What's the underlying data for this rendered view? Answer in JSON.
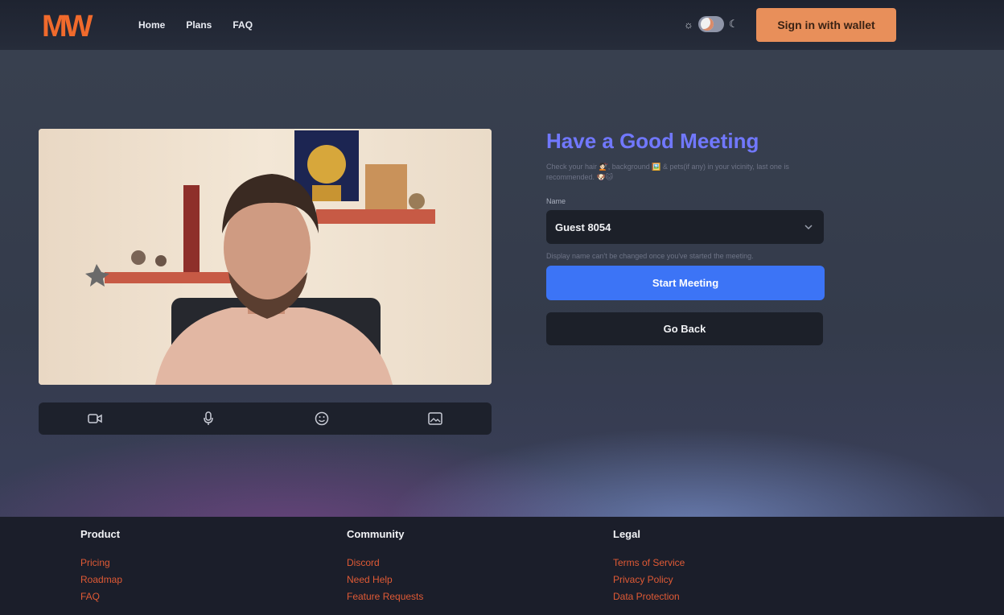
{
  "header": {
    "logo_text": "MW",
    "nav": [
      {
        "label": "Home"
      },
      {
        "label": "Plans"
      },
      {
        "label": "FAQ"
      }
    ],
    "theme_toggle": {
      "light_icon": "sun-icon",
      "dark_icon": "moon-icon",
      "mode": "light"
    },
    "wallet_button": "Sign in with wallet"
  },
  "preview": {
    "controls": [
      {
        "icon": "camera-icon"
      },
      {
        "icon": "microphone-icon"
      },
      {
        "icon": "smiley-icon"
      },
      {
        "icon": "background-image-icon"
      }
    ]
  },
  "panel": {
    "title": "Have a Good Meeting",
    "subtitle": "Check your hair 💇🏻, background 🖼️ & pets(if any) in your vicinity, last one is recommended. 🐶🐱",
    "name_label": "Name",
    "name_value": "Guest 8054",
    "hint": "Display name can't be changed once you've started the meeting.",
    "start_button": "Start Meeting",
    "back_button": "Go Back"
  },
  "footer": {
    "columns": [
      {
        "heading": "Product",
        "links": [
          "Pricing",
          "Roadmap",
          "FAQ"
        ]
      },
      {
        "heading": "Community",
        "links": [
          "Discord",
          "Need Help",
          "Feature Requests"
        ]
      },
      {
        "heading": "Legal",
        "links": [
          "Terms of Service",
          "Privacy Policy",
          "Data Protection"
        ]
      }
    ]
  },
  "colors": {
    "accent": "#3c74f6",
    "title": "#7178ff",
    "wallet": "#e88f5a",
    "footer_link": "#e05a35"
  }
}
